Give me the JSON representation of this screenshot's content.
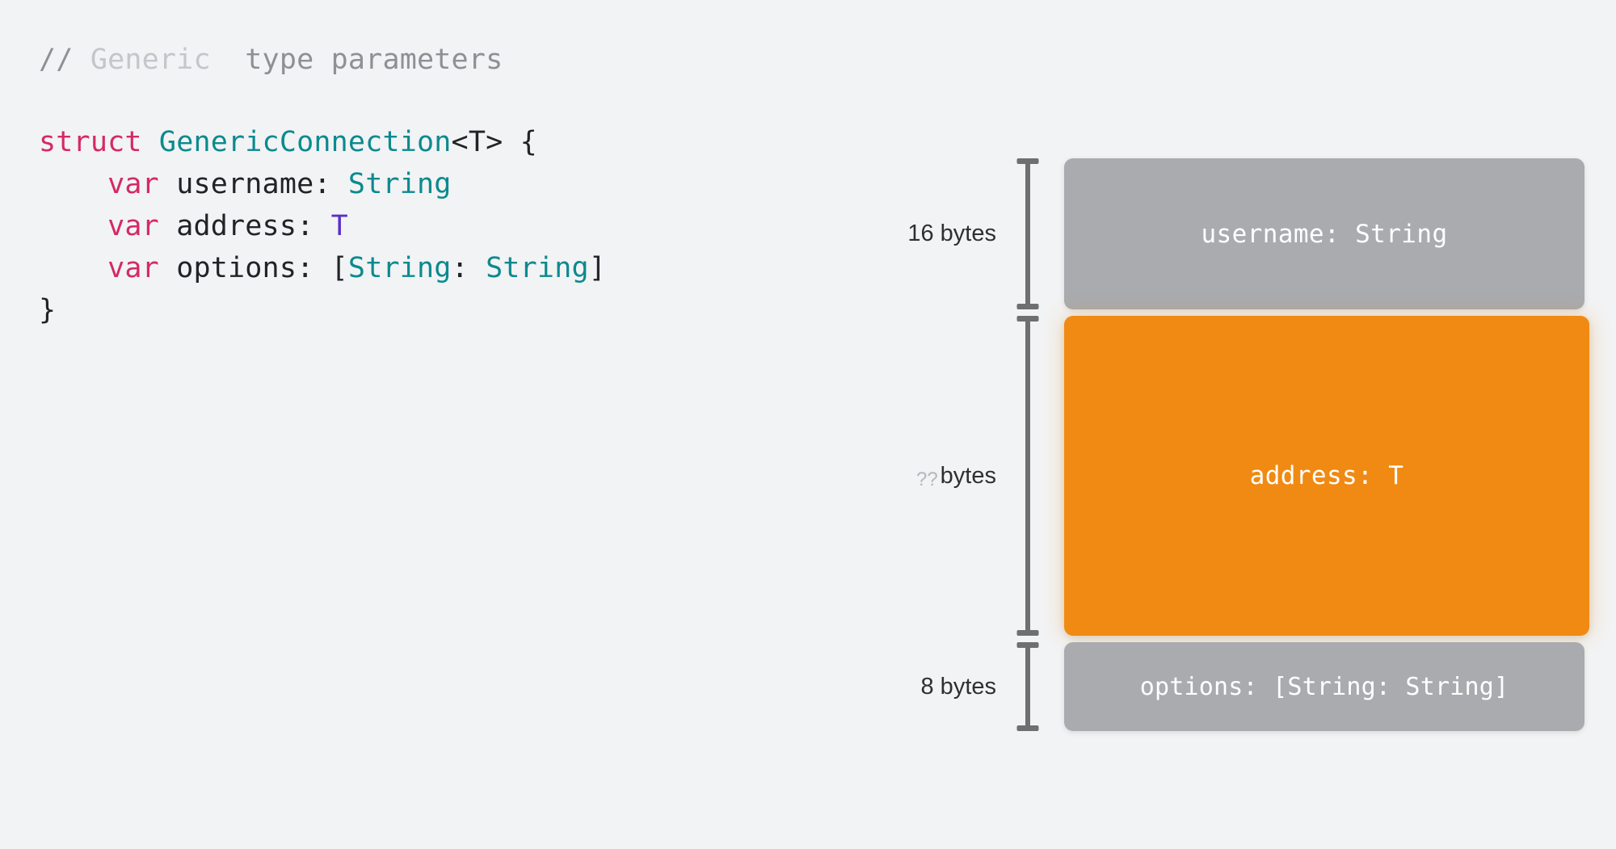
{
  "code": {
    "comment": {
      "slashes": "// ",
      "faded_word": "Generic",
      "gap": "  ",
      "rest": "type parameters"
    },
    "lines": [
      {
        "id": "struct-decl",
        "tokens": [
          {
            "t": "struct",
            "k": "kw"
          },
          {
            "t": " ",
            "k": "plain"
          },
          {
            "t": "GenericConnection",
            "k": "type"
          },
          {
            "t": "<T>",
            "k": "plain"
          },
          {
            "t": " ",
            "k": "plain"
          },
          {
            "t": "{",
            "k": "punct"
          }
        ]
      },
      {
        "id": "var-username",
        "tokens": [
          {
            "t": "    ",
            "k": "plain"
          },
          {
            "t": "var",
            "k": "kw"
          },
          {
            "t": " username: ",
            "k": "plain"
          },
          {
            "t": "String",
            "k": "type"
          }
        ]
      },
      {
        "id": "var-address",
        "tokens": [
          {
            "t": "    ",
            "k": "plain"
          },
          {
            "t": "var",
            "k": "kw"
          },
          {
            "t": " address: ",
            "k": "plain"
          },
          {
            "t": "T",
            "k": "generic"
          }
        ]
      },
      {
        "id": "var-options",
        "tokens": [
          {
            "t": "    ",
            "k": "plain"
          },
          {
            "t": "var",
            "k": "kw"
          },
          {
            "t": " options: ",
            "k": "plain"
          },
          {
            "t": "[",
            "k": "punct"
          },
          {
            "t": "String",
            "k": "type"
          },
          {
            "t": ": ",
            "k": "plain"
          },
          {
            "t": "String",
            "k": "type"
          },
          {
            "t": "]",
            "k": "punct"
          }
        ]
      },
      {
        "id": "close-brace",
        "tokens": [
          {
            "t": "}",
            "k": "punct"
          }
        ]
      }
    ]
  },
  "diagram": {
    "rows": [
      {
        "id": "username",
        "size_label": "16 bytes",
        "size_unknown": "",
        "block_label": "username: String",
        "color": "#a9abae",
        "kind": "gray"
      },
      {
        "id": "address",
        "size_label": "bytes",
        "size_unknown": "??",
        "block_label": "address: T",
        "color": "#f08a12",
        "kind": "orange"
      },
      {
        "id": "options",
        "size_label": "8 bytes",
        "size_unknown": "",
        "block_label": "options: [String: String]",
        "color": "#a9abae",
        "kind": "gray"
      }
    ]
  },
  "colors": {
    "background": "#f2f3f4",
    "keyword": "#d42a63",
    "type": "#0b8a8f",
    "generic_param": "#5a2fc9",
    "plain_text": "#222326",
    "comment": "#8d9095",
    "comment_faded": "#c3c6ca",
    "block_gray": "#a9abae",
    "block_orange": "#f08a12",
    "beam": "#6e6f71",
    "label_text": "#2e2f31",
    "label_unknown": "#b4b7bb"
  }
}
